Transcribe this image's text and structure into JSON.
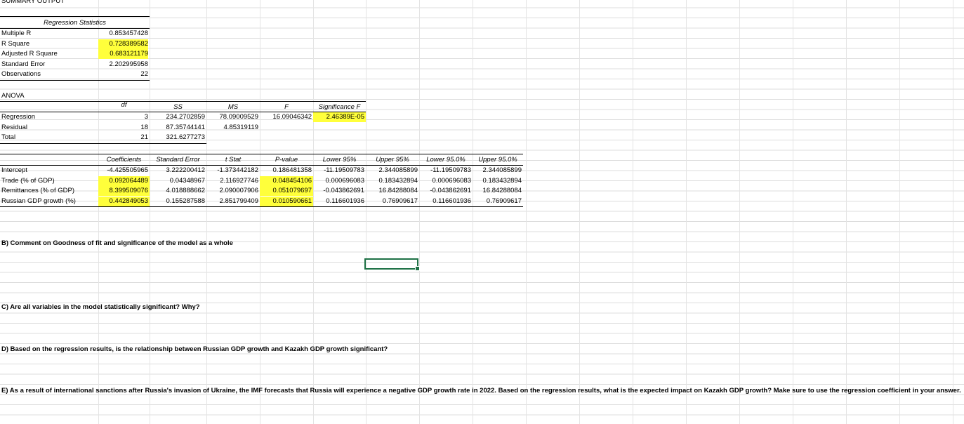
{
  "title": "SUMMARY OUTPUT",
  "regression_statistics": {
    "header": "Regression Statistics",
    "rows": [
      {
        "label": "Multiple R",
        "value": "0.853457428",
        "highlight": false
      },
      {
        "label": "R Square",
        "value": "0.728389582",
        "highlight": true
      },
      {
        "label": "Adjusted R Square",
        "value": "0.683121179",
        "highlight": true
      },
      {
        "label": "Standard Error",
        "value": "2.202995958",
        "highlight": false
      },
      {
        "label": "Observations",
        "value": "22",
        "highlight": false
      }
    ]
  },
  "anova": {
    "title": "ANOVA",
    "headers": [
      "df",
      "SS",
      "MS",
      "F",
      "Significance F"
    ],
    "rows": [
      {
        "label": "Regression",
        "df": "3",
        "ss": "234.2702859",
        "ms": "78.09009529",
        "f": "16.09046342",
        "sig": "2.46389E-05"
      },
      {
        "label": "Residual",
        "df": "18",
        "ss": "87.35744141",
        "ms": "4.85319119",
        "f": "",
        "sig": ""
      },
      {
        "label": "Total",
        "df": "21",
        "ss": "321.6277273",
        "ms": "",
        "f": "",
        "sig": ""
      }
    ]
  },
  "coefficients": {
    "headers": [
      "Coefficients",
      "Standard Error",
      "t Stat",
      "P-value",
      "Lower 95%",
      "Upper 95%",
      "Lower 95.0%",
      "Upper 95.0%"
    ],
    "rows": [
      {
        "label": "Intercept",
        "values": [
          "-4.425505965",
          "3.222200412",
          "-1.373442182",
          "0.186481358",
          "-11.19509783",
          "2.344085899",
          "-11.19509783",
          "2.344085899"
        ],
        "hl_coef": false,
        "hl_p": false
      },
      {
        "label": "Trade (% of GDP)",
        "values": [
          "0.092064489",
          "0.04348967",
          "2.116927746",
          "0.048454106",
          "0.000696083",
          "0.183432894",
          "0.000696083",
          "0.183432894"
        ],
        "hl_coef": true,
        "hl_p": true
      },
      {
        "label": "Remittances (% of GDP)",
        "values": [
          "8.399509076",
          "4.018888662",
          "2.090007906",
          "0.051079697",
          "-0.043862691",
          "16.84288084",
          "-0.043862691",
          "16.84288084"
        ],
        "hl_coef": true,
        "hl_p": true
      },
      {
        "label": "Russian GDP growth (%)",
        "values": [
          "0.442849053",
          "0.155287588",
          "2.851799409",
          "0.010590661",
          "0.116601936",
          "0.76909617",
          "0.116601936",
          "0.76909617"
        ],
        "hl_coef": true,
        "hl_p": true
      }
    ]
  },
  "questions": {
    "b": "B) Comment on Goodness of fit and significance of the model as a whole",
    "c": "C) Are all variables in the model statistically significant? Why?",
    "d": "D) Based on the regression results, is the relationship between Russian GDP growth and Kazakh GDP growth significant?",
    "e": "E) As a result of international sanctions after Russia's invasion of Ukraine, the IMF forecasts that Russia will experience a negative GDP growth rate in 2022. Based on the regression results, what is the expected impact on Kazakh GDP growth? Make sure to use the regression coefficient in your answer."
  },
  "colors": {
    "highlight": "#ffff3b",
    "selection": "#1e7145",
    "gridline": "#dcdcdc"
  }
}
